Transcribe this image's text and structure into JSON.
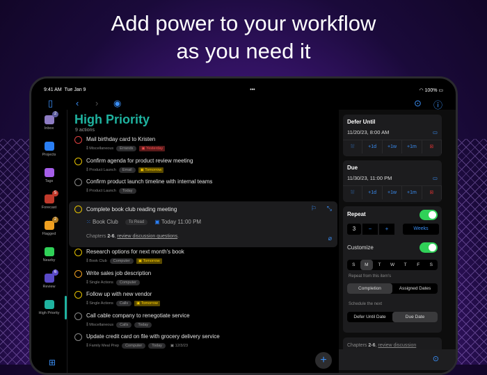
{
  "headline": [
    "Add power to your workflow",
    "as you need it"
  ],
  "status": {
    "time": "9:41 AM",
    "date": "Tue Jan 9",
    "battery": "100%"
  },
  "sidebar": [
    {
      "label": "Inbox",
      "badge": "2",
      "color": "#8e7cc3",
      "badge_color": "#5a5a9a"
    },
    {
      "label": "Projects",
      "badge": "",
      "color": "#2a7ff5"
    },
    {
      "label": "Tags",
      "badge": "",
      "color": "#a55ee8"
    },
    {
      "label": "Forecast",
      "badge": "5",
      "color": "#c0392b",
      "badge_color": "#c0392b"
    },
    {
      "label": "Flagged",
      "badge": "2",
      "color": "#f0a020",
      "badge_color": "#b07a20"
    },
    {
      "label": "Nearby",
      "badge": "",
      "color": "#30d158"
    },
    {
      "label": "Review",
      "badge": "6",
      "color": "#5a4ac8",
      "badge_color": "#5a4ac8"
    },
    {
      "label": "High Priority",
      "badge": "",
      "color": "#1fb3a0"
    }
  ],
  "main": {
    "title": "High Priority",
    "count": "9 actions",
    "tasks": [
      {
        "title": "Mail birthday card to Kristen",
        "project": "Miscellaneous",
        "tags": [
          "Errands"
        ],
        "due": "Yesterday",
        "due_style": "overdue",
        "ring": "#e04040"
      },
      {
        "title": "Confirm agenda for product review meeting",
        "project": "Product Launch",
        "tags": [
          "Email"
        ],
        "due": "Tomorrow",
        "due_style": "soon",
        "ring": "#e6c200"
      },
      {
        "title": "Confirm product launch timeline with internal teams",
        "project": "Product Launch",
        "tags": [
          "Today"
        ],
        "due": "",
        "ring": "#888"
      },
      {
        "title": "Research options for next month's book",
        "project": "Book Club",
        "tags": [
          "Computer"
        ],
        "due": "Tomorrow",
        "due_style": "soon",
        "ring": "#e6c200"
      },
      {
        "title": "Write sales job description",
        "project": "Single Actions",
        "tags": [
          "Computer"
        ],
        "due": "",
        "ring": "#f0a020"
      },
      {
        "title": "Follow up with new vendor",
        "project": "Single Actions",
        "tags": [
          "Calls"
        ],
        "due": "Tomorrow",
        "due_style": "soon",
        "ring": "#e6c200"
      },
      {
        "title": "Call cable company to renegotiate service",
        "project": "Miscellaneous",
        "tags": [
          "Calls",
          "Today"
        ],
        "due": "",
        "ring": "#888"
      },
      {
        "title": "Update credit card on file with grocery delivery service",
        "project": "Family Meal Prep",
        "tags": [
          "Computer",
          "Today"
        ],
        "due": "12/3/23",
        "due_style": "plain",
        "ring": "#888"
      }
    ],
    "selected": {
      "title": "Complete book club reading meeting",
      "project": "Book Club",
      "tag": "To Read",
      "due": "Today 11:00 PM",
      "note_prefix": "Chapters ",
      "note_bold": "2-6",
      ", ": ", ",
      "note_link": "review discussion questions",
      "note_end": "."
    }
  },
  "inspector": {
    "defer": {
      "label": "Defer Until",
      "value": "11/20/23, 8:00 AM"
    },
    "due": {
      "label": "Due",
      "value": "11/30/23, 11:00 PM"
    },
    "quick": [
      "+1d",
      "+1w",
      "+1m"
    ],
    "repeat": {
      "label": "Repeat",
      "count": "3",
      "unit": "Weeks",
      "customize": "Customize",
      "days": [
        "S",
        "M",
        "T",
        "W",
        "T",
        "F",
        "S"
      ],
      "from_label": "Repeat from this item's",
      "from_opts": [
        "Completion",
        "Assigned Dates"
      ],
      "sched_label": "Schedule the next",
      "sched_opts": [
        "Defer Until Date",
        "Due Date"
      ]
    },
    "note_prefix": "Chapters ",
    "note_bold": "2-6",
    "note_link": "review discussion"
  }
}
